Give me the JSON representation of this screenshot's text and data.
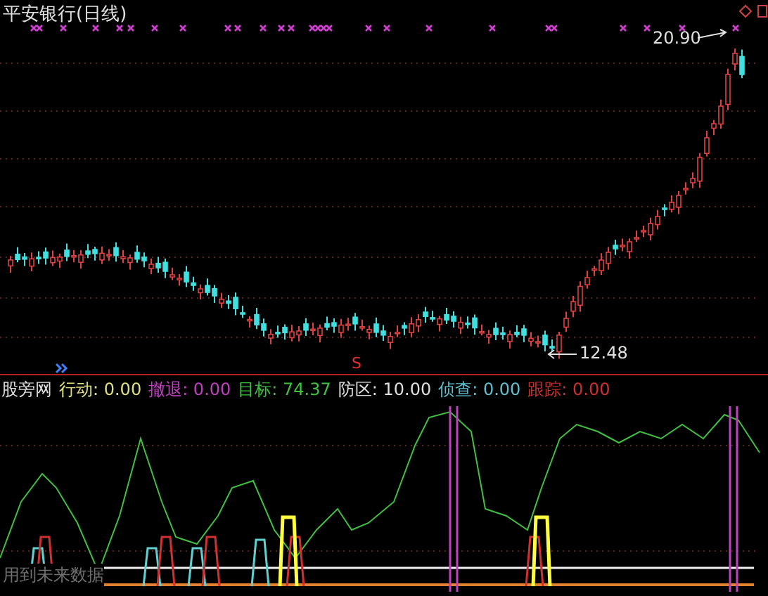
{
  "price_panel": {
    "title": "平安银行(日线)",
    "high_label": "20.90",
    "low_label": "12.48",
    "signal_letter": "S"
  },
  "indicator_panel": {
    "name": "股旁网",
    "items": [
      {
        "text": "行动: 0.00",
        "color": "#e0e080"
      },
      {
        "text": "撤退: 0.00",
        "color": "#c040c0"
      },
      {
        "text": "目标: 74.37",
        "color": "#40c040"
      },
      {
        "text": "防区: 10.00",
        "color": "#e0e0e0"
      },
      {
        "text": "侦查: 0.00",
        "color": "#60c0d0"
      },
      {
        "text": "跟踪: 0.00",
        "color": "#d03030"
      }
    ],
    "notice": "用到未来数据"
  }
}
